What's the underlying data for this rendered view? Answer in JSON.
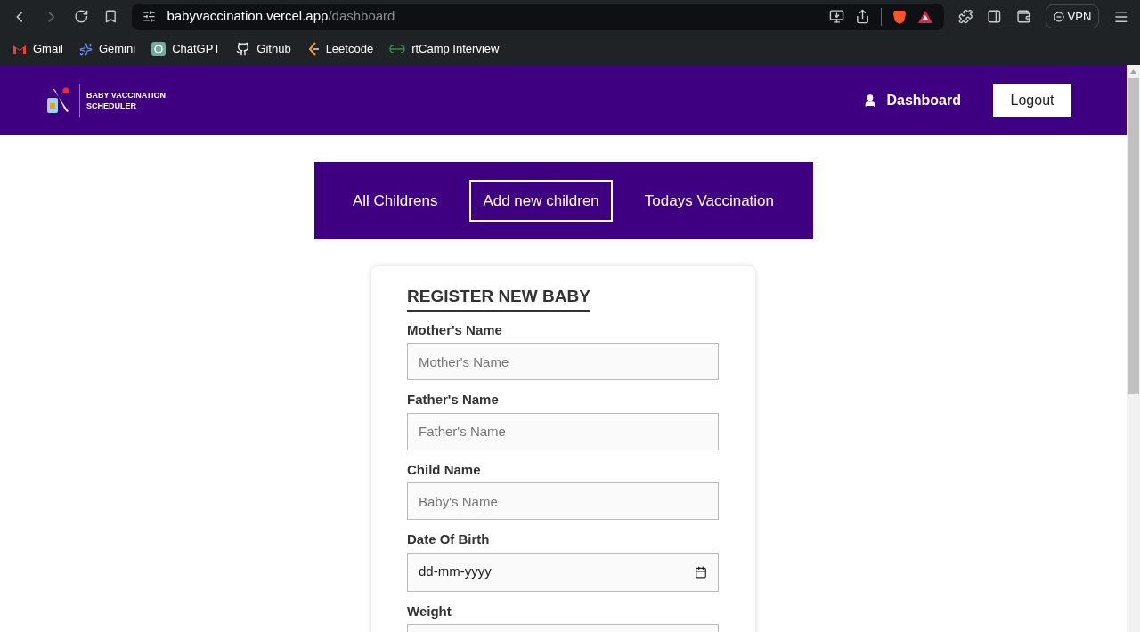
{
  "browser": {
    "url": {
      "host": "babyvaccination.vercel.app",
      "path": "/dashboard"
    },
    "bookmarks": [
      {
        "label": "Gmail",
        "kind": "gmail"
      },
      {
        "label": "Gemini",
        "kind": "gemini"
      },
      {
        "label": "ChatGPT",
        "kind": "chatgpt"
      },
      {
        "label": "Github",
        "kind": "github"
      },
      {
        "label": "Leetcode",
        "kind": "leetcode"
      },
      {
        "label": "rtCamp Interview",
        "kind": "gfg"
      }
    ],
    "vpn": "VPN"
  },
  "header": {
    "brand": "BABY VACCINATION SCHEDULER",
    "nav_link": "Dashboard",
    "logout_button": "Logout"
  },
  "tabs": [
    {
      "label": "All Childrens",
      "selected": false
    },
    {
      "label": "Add new children",
      "selected": true
    },
    {
      "label": "Todays Vaccination",
      "selected": false
    }
  ],
  "form": {
    "title": "REGISTER NEW BABY",
    "fields": [
      {
        "label": "Mother's Name",
        "kind": "text",
        "placeholder": "Mother's Name"
      },
      {
        "label": "Father's Name",
        "kind": "text",
        "placeholder": "Father's Name"
      },
      {
        "label": "Child Name",
        "kind": "text",
        "placeholder": "Baby's Name"
      },
      {
        "label": "Date Of Birth",
        "kind": "date",
        "placeholder": "dd-mm-yyyy"
      },
      {
        "label": "Weight",
        "kind": "text"
      }
    ]
  }
}
